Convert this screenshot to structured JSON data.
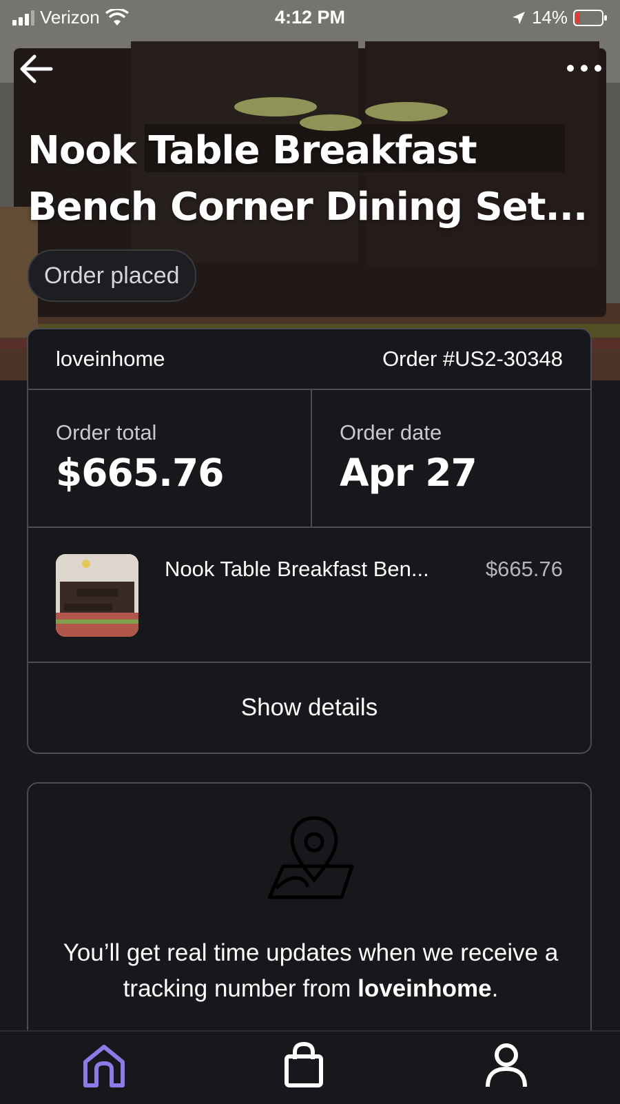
{
  "status_bar": {
    "carrier": "Verizon",
    "time": "4:12 PM",
    "battery": "14%"
  },
  "header": {
    "title": "Nook Table Breakfast Bench Corner Dining Set...",
    "status_pill": "Order placed"
  },
  "order": {
    "seller": "loveinhome",
    "order_number": "Order #US2-30348",
    "total_label": "Order total",
    "total_value": "$665.76",
    "date_label": "Order date",
    "date_value": "Apr 27",
    "item_name": "Nook Table Breakfast Ben...",
    "item_price": "$665.76",
    "show_details": "Show details"
  },
  "tracking": {
    "message_prefix": "You’ll get real time updates when we receive a tracking number from ",
    "seller": "loveinhome",
    "message_suffix": "."
  },
  "tabs": [
    {
      "name": "home-icon",
      "active": true
    },
    {
      "name": "bag-icon",
      "active": false
    },
    {
      "name": "profile-icon",
      "active": false
    }
  ],
  "colors": {
    "accent": "#8c7ae6",
    "background": "#17181b",
    "border": "#4a4a50"
  }
}
